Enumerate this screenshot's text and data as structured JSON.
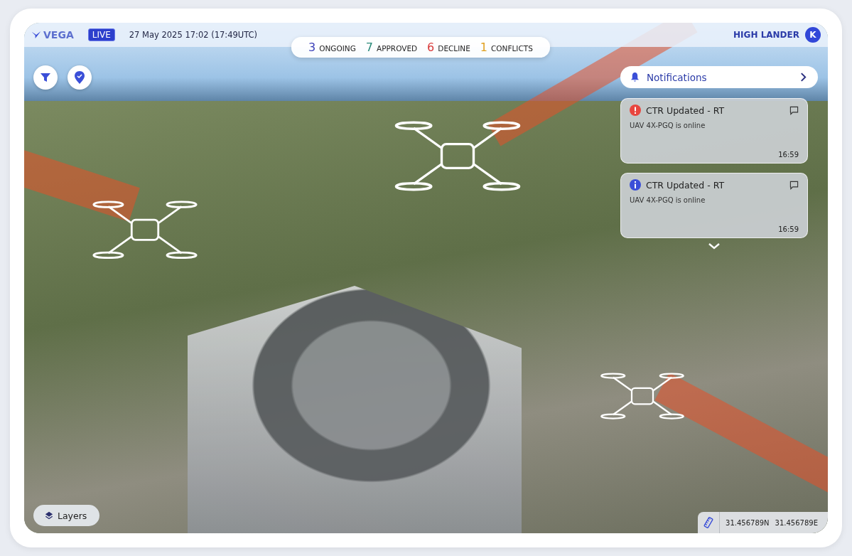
{
  "brand": {
    "name": "VEGA"
  },
  "live_badge": "LIVE",
  "datetime": "27 May 2025  17:02 (17:49UTC)",
  "stats": [
    {
      "count": "3",
      "label": "ONGOING",
      "color": "#3a3fb8"
    },
    {
      "count": "7",
      "label": "APPROVED",
      "color": "#2a8a7a"
    },
    {
      "count": "6",
      "label": "DECLINE",
      "color": "#d93a3a"
    },
    {
      "count": "1",
      "label": "CONFLICTS",
      "color": "#e0a020"
    }
  ],
  "user": {
    "name": "HIGH LANDER",
    "initial": "K"
  },
  "notifications": {
    "title": "Notifications",
    "items": [
      {
        "kind": "alert",
        "title": "CTR Updated - RT",
        "message": "UAV 4X-PGQ is online",
        "time": "16:59"
      },
      {
        "kind": "info",
        "title": "CTR Updated - RT",
        "message": "UAV 4X-PGQ is online",
        "time": "16:59"
      }
    ]
  },
  "layers_button": "Layers",
  "coordinates": {
    "lat": "31.456789N",
    "lon": "31.456789E"
  }
}
